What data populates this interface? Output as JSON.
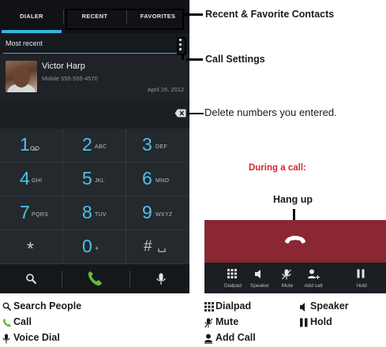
{
  "dialer": {
    "tabs": [
      "DIALER",
      "RECENT",
      "FAVORITES"
    ],
    "section_title": "Most recent",
    "contact": {
      "name": "Victor Harp",
      "number": "Mobile 555-555-4570",
      "date": "April 26, 2012"
    },
    "keys": [
      {
        "digit": "1",
        "letters": ""
      },
      {
        "digit": "2",
        "letters": "ABC"
      },
      {
        "digit": "3",
        "letters": "DEF"
      },
      {
        "digit": "4",
        "letters": "GHI"
      },
      {
        "digit": "5",
        "letters": "JKL"
      },
      {
        "digit": "6",
        "letters": "MNO"
      },
      {
        "digit": "7",
        "letters": "PQRS"
      },
      {
        "digit": "8",
        "letters": "TUV"
      },
      {
        "digit": "9",
        "letters": "WXYZ"
      },
      {
        "digit": "*",
        "letters": ""
      },
      {
        "digit": "0",
        "letters": "+"
      },
      {
        "digit": "#",
        "letters": ""
      }
    ]
  },
  "incall": {
    "buttons": [
      "Dialpad",
      "Speaker",
      "Mute",
      "Add call",
      "Hold"
    ]
  },
  "callouts": {
    "recent_favorites": "Recent & Favorite Contacts",
    "call_settings": "Call Settings",
    "delete": "Delete numbers you entered.",
    "during_call": "During a call:",
    "hang_up": "Hang up"
  },
  "legend": {
    "search": "Search People",
    "call": "Call",
    "voice_dial": "Voice Dial",
    "dialpad": "Dialpad",
    "speaker": "Speaker",
    "mute": "Mute",
    "hold": "Hold",
    "add_call": "Add Call"
  },
  "colors": {
    "accent": "#33b5e5",
    "call_green": "#5fbf3c",
    "hangup_bg": "#8a2732",
    "callout_red": "#d8262e"
  }
}
